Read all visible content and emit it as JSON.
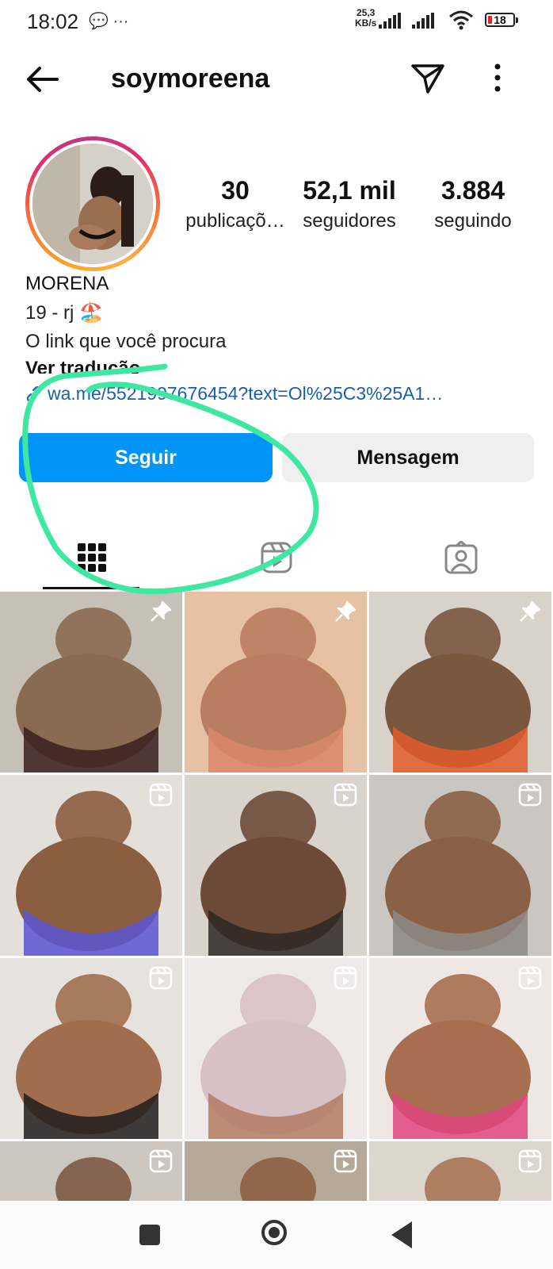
{
  "status_bar": {
    "time": "18:02",
    "left_icons": "💬 ···",
    "net_speed": "25,3",
    "net_unit": "KB/s",
    "battery": "18"
  },
  "header": {
    "username": "soymoreena",
    "back_icon": "arrow-left-icon",
    "send_icon": "paper-plane-icon",
    "more_icon": "vertical-dots-icon"
  },
  "profile": {
    "stats": [
      {
        "value": "30",
        "label": "publicaçõ…"
      },
      {
        "value": "52,1 mil",
        "label": "seguidores"
      },
      {
        "value": "3.884",
        "label": "seguindo"
      }
    ],
    "name": "MORENA",
    "bio_line1": "19 - rj 🏖️",
    "bio_line2": "O link que você procura",
    "see_translation": "Ver tradução",
    "link": "wa.me/5521997676454?text=Ol%25C3%25A1…"
  },
  "actions": {
    "follow_label": "Seguir",
    "message_label": "Mensagem"
  },
  "tabs": [
    {
      "name": "grid",
      "icon": "grid-icon"
    },
    {
      "name": "reels",
      "icon": "reels-icon"
    },
    {
      "name": "tagged",
      "icon": "tagged-person-icon"
    }
  ],
  "posts": [
    {
      "badge": "pin-icon",
      "colors": [
        "#c7c0b6",
        "#8b6a52",
        "#3a1f1f"
      ]
    },
    {
      "badge": "pin-icon",
      "colors": [
        "#e6c1a3",
        "#b97d5f",
        "#d9866a"
      ]
    },
    {
      "badge": "pin-icon",
      "colors": [
        "#d8d2cb",
        "#7a573f",
        "#e25a2a"
      ]
    },
    {
      "badge": "reels-icon",
      "colors": [
        "#e4dfd8",
        "#8c5e41",
        "#5a55d6"
      ]
    },
    {
      "badge": "reels-icon",
      "colors": [
        "#d9d3cc",
        "#6d4a37",
        "#2f2723"
      ]
    },
    {
      "badge": "reels-icon",
      "colors": [
        "#cbc7c0",
        "#8a6046",
        "#8d8a86"
      ]
    },
    {
      "badge": "reels-icon",
      "colors": [
        "#e6e3df",
        "#a06e4f",
        "#1f1c1c"
      ]
    },
    {
      "badge": "reels-icon",
      "colors": [
        "#efe9ea",
        "#d7c1c6",
        "#b17a62"
      ]
    },
    {
      "badge": "reels-icon",
      "colors": [
        "#efe7e4",
        "#a76f50",
        "#e0457f"
      ]
    },
    {
      "badge": "reels-icon",
      "colors": [
        "#ccc6bf",
        "#7d5a45",
        "#2c2a2a"
      ]
    },
    {
      "badge": "reels-icon",
      "colors": [
        "#b7a99a",
        "#8e5e42",
        "#6fa3d3"
      ]
    },
    {
      "badge": "reels-icon",
      "colors": [
        "#ddd6cc",
        "#a87456",
        "#c46a3c"
      ]
    }
  ],
  "colors": {
    "accent": "#0095f6",
    "link": "#1a5fae",
    "annotation": "#3ee8a0"
  }
}
